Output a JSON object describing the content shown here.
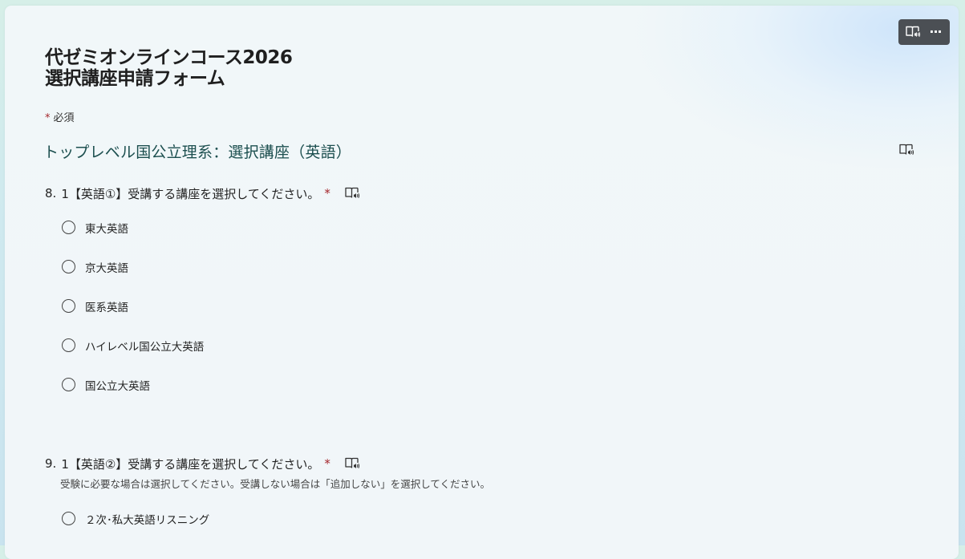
{
  "form": {
    "title_line1": "代ゼミオンラインコース2026",
    "title_line2": "選択講座申請フォーム",
    "required_star": "*",
    "required_label": "必須",
    "section_title": "トップレベル国公立理系：選択講座（英語）"
  },
  "toolbar": {
    "reader_icon": "immersive-reader-icon",
    "more_icon": "more-options-icon",
    "more_glyph": "···"
  },
  "questions": [
    {
      "number": "8.",
      "text": "1【英語①】受講する講座を選択してください。",
      "required": "*",
      "subtitle": "",
      "options": [
        "東大英語",
        "京大英語",
        "医系英語",
        "ハイレベル国公立大英語",
        "国公立大英語"
      ]
    },
    {
      "number": "9.",
      "text": "1【英語②】受講する講座を選択してください。",
      "required": "*",
      "subtitle": "受験に必要な場合は選択してください。受講しない場合は「追加しない」を選択してください。",
      "options": [
        "２次･私大英語リスニング"
      ]
    }
  ],
  "colors": {
    "accent_teal": "#1c4f4f",
    "required_red": "#a4262c",
    "toolbar_bg": "#4b4f54"
  }
}
